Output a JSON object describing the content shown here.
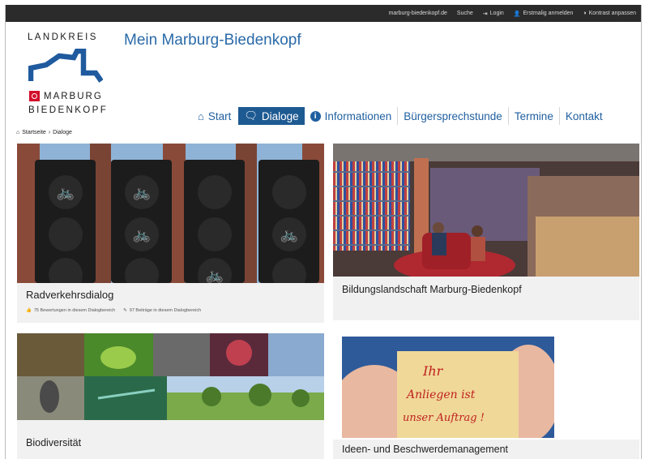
{
  "topbar": {
    "links": [
      {
        "label": "marburg-biedenkopf.de",
        "icon": ""
      },
      {
        "label": "Suche",
        "icon": ""
      },
      {
        "label": "Login",
        "icon": "sign-in-icon"
      },
      {
        "label": "Erstmalig anmelden",
        "icon": "user-plus-icon"
      },
      {
        "label": "Kontrast anpassen",
        "icon": "contrast-icon"
      }
    ]
  },
  "logo": {
    "line1": "LANDKREIS",
    "line2": "MARBURG",
    "line3": "BIEDENKOPF"
  },
  "site": {
    "title": "Mein Marburg-Biedenkopf"
  },
  "nav": {
    "items": [
      {
        "label": "Start",
        "icon": "home-icon",
        "active": false
      },
      {
        "label": "Dialoge",
        "icon": "comments-icon",
        "active": true
      },
      {
        "label": "Informationen",
        "icon": "info-icon",
        "active": false
      },
      {
        "label": "Bürgersprechstunde",
        "icon": "",
        "active": false
      },
      {
        "label": "Termine",
        "icon": "",
        "active": false
      },
      {
        "label": "Kontakt",
        "icon": "",
        "active": false
      }
    ]
  },
  "breadcrumb": {
    "items": [
      "Startseite",
      "Dialoge"
    ],
    "separator": "›"
  },
  "cards": [
    {
      "title": "Radverkehrsdialog",
      "meta": [
        {
          "icon": "thumbs-up-icon",
          "text": "75 Bewertungen in diesem Dialogbereich"
        },
        {
          "icon": "pencil-icon",
          "text": "97 Beiträge in diesem Dialogbereich"
        }
      ]
    },
    {
      "title": "Bildungslandschaft Marburg-Biedenkopf"
    },
    {
      "title": "Biodiversität"
    },
    {
      "title": "Ideen- und Beschwerdemanagement",
      "note_text": [
        "Ihr",
        "Anliegen ist",
        "unser Auftrag !"
      ]
    }
  ],
  "colors": {
    "topbar": "#2b2b2b",
    "link_blue": "#1f5f9f",
    "nav_active": "#1e5a92",
    "logo_blue": "#1f5a9e",
    "logo_red": "#d20f2a",
    "card_bg": "#f1f1f1"
  }
}
